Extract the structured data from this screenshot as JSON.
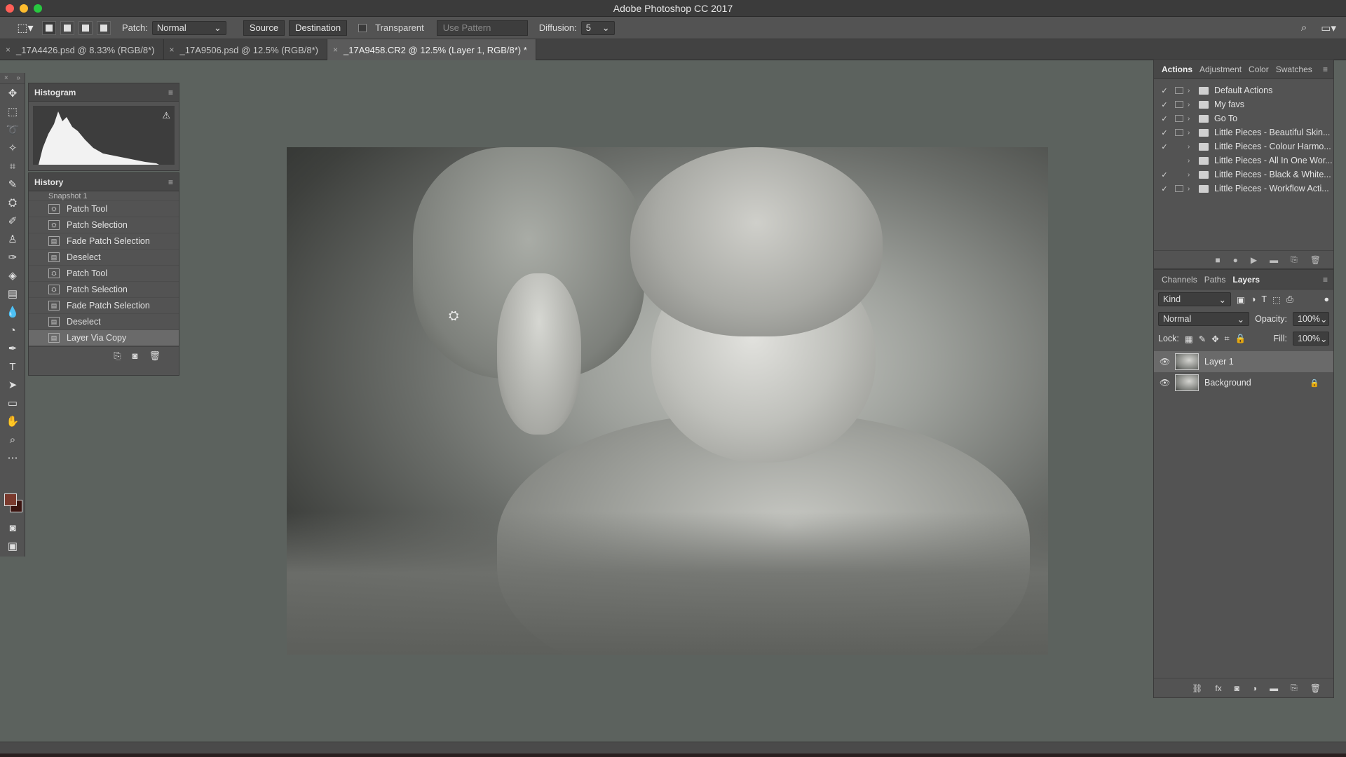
{
  "window": {
    "title": "Adobe Photoshop CC 2017"
  },
  "options": {
    "patch_label": "Patch:",
    "patch_mode": "Normal",
    "source_label": "Source",
    "destination_label": "Destination",
    "transparent_label": "Transparent",
    "use_pattern_label": "Use Pattern",
    "diffusion_label": "Diffusion:",
    "diffusion_value": "5"
  },
  "tabs": [
    {
      "label": "_17A4426.psd @ 8.33% (RGB/8*)"
    },
    {
      "label": "_17A9506.psd @ 12.5% (RGB/8*)"
    },
    {
      "label": "_17A9458.CR2 @ 12.5% (Layer 1, RGB/8*) *"
    }
  ],
  "histogram": {
    "title": "Histogram"
  },
  "history": {
    "title": "History",
    "snapshot": "Snapshot 1",
    "items": [
      {
        "label": "Patch Tool",
        "icon": "patch-icon"
      },
      {
        "label": "Patch Selection",
        "icon": "patch-icon"
      },
      {
        "label": "Fade Patch Selection",
        "icon": "doc-icon"
      },
      {
        "label": "Deselect",
        "icon": "doc-icon"
      },
      {
        "label": "Patch Tool",
        "icon": "patch-icon"
      },
      {
        "label": "Patch Selection",
        "icon": "patch-icon"
      },
      {
        "label": "Fade Patch Selection",
        "icon": "doc-icon"
      },
      {
        "label": "Deselect",
        "icon": "doc-icon"
      },
      {
        "label": "Layer Via Copy",
        "icon": "doc-icon"
      }
    ]
  },
  "actions_panel": {
    "tabs": [
      "Actions",
      "Adjustment",
      "Color",
      "Swatches"
    ],
    "items": [
      {
        "label": "Default Actions",
        "checked": true,
        "modal": true
      },
      {
        "label": "My favs",
        "checked": true,
        "modal": true
      },
      {
        "label": "Go To",
        "checked": true,
        "modal": true
      },
      {
        "label": "Little Pieces - Beautiful Skin...",
        "checked": true,
        "modal": true
      },
      {
        "label": "Little Pieces - Colour Harmo...",
        "checked": true,
        "modal": false
      },
      {
        "label": "Little Pieces - All In One Wor...",
        "checked": false,
        "modal": false
      },
      {
        "label": "Little Pieces - Black & White...",
        "checked": true,
        "modal": false
      },
      {
        "label": "Little Pieces - Workflow Acti...",
        "checked": true,
        "modal": true
      }
    ]
  },
  "layers_panel": {
    "tabs": [
      "Channels",
      "Paths",
      "Layers"
    ],
    "filter": "Kind",
    "blend_mode": "Normal",
    "opacity_label": "Opacity:",
    "opacity": "100%",
    "lock_label": "Lock:",
    "fill_label": "Fill:",
    "fill": "100%",
    "layers": [
      {
        "name": "Layer 1"
      },
      {
        "name": "Background"
      }
    ]
  },
  "colors": {
    "foreground": "#7a3a2e",
    "background": "#3b1410",
    "accent": "#535353"
  }
}
